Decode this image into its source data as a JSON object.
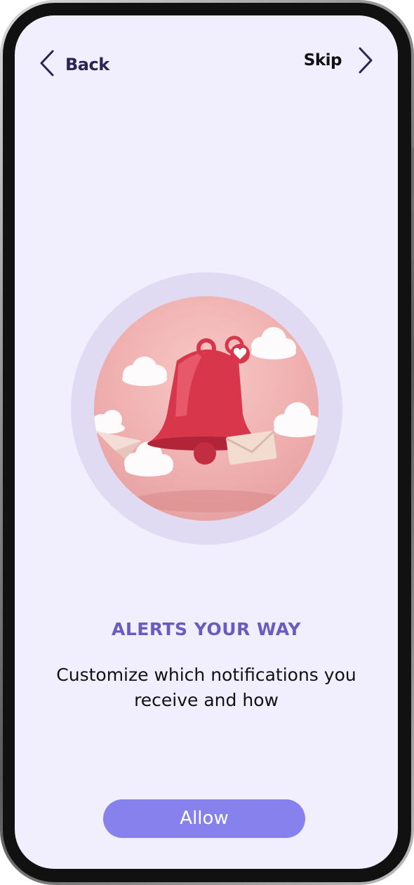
{
  "nav": {
    "back_label": "Back",
    "skip_label": "Skip"
  },
  "hero": {
    "icon": "notification-bell-illustration"
  },
  "content": {
    "title": "ALERTS YOUR WAY",
    "subtitle": "Customize which notifications you receive and how"
  },
  "actions": {
    "allow_label": "Allow"
  },
  "colors": {
    "screen_bg": "#f1eefe",
    "accent": "#8781ee",
    "title": "#6a5bbf",
    "nav_text": "#2d2356",
    "hero_ring": "#e0dbf3"
  }
}
